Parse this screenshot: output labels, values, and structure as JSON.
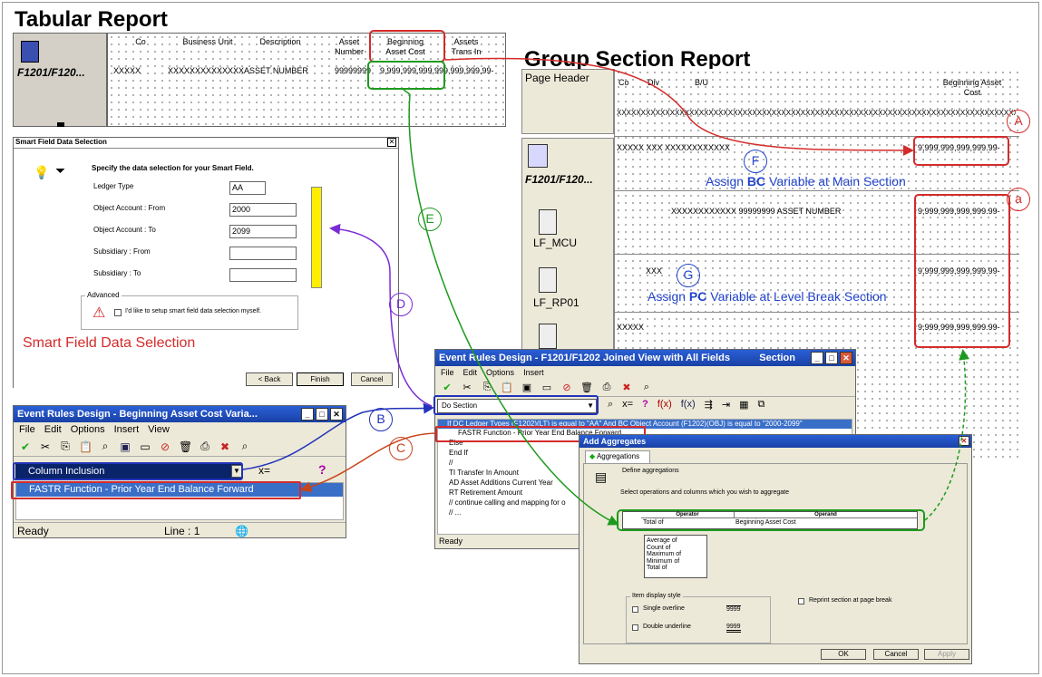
{
  "titles": {
    "tabular": "Tabular Report",
    "group": "Group Section Report"
  },
  "tabular": {
    "section_label": "F1201/F120...",
    "columns": [
      "Co",
      "Business Unit",
      "Description",
      "Asset Number",
      "Beginning Asset Cost",
      "Assets Trans In"
    ],
    "values": [
      "XXXXX",
      "XXXXXXXXXXXXXX",
      "ASSET NUMBER",
      "99999999",
      "9,999,999,999,99",
      "9,999,999,99-"
    ]
  },
  "group": {
    "page_header": "Page Header",
    "header_cols": {
      "co": "Co",
      "div": "Div",
      "bu": "B/U",
      "bac": "Beginning Asset Cost"
    },
    "x_line": "XXXXXXXXXXXXXXXXXXXXXXXXXXXXXXXXXXXXXXXXXXXXXXXXXXXXXXXXXXXXXXXXXXXXXXXXXXXXXXXXXXXXXXXXXXXXXXXXXXXXXXXXXXXXXXXX",
    "main_label": "F1201/F120...",
    "main_row": "XXXXX  XXX  XXXXXXXXXXXX",
    "value": "9,999,999,999,999.99-",
    "lf_mcu": "LF_MCU",
    "lf_mcu_row": "XXXXXXXXXXXX  99999999  ASSET NUMBER",
    "lf_rp01": "LF_RP01",
    "lf_rp01_row": "XXX",
    "last_row": "XXXXX",
    "assign_bc": {
      "pre": "Assign ",
      "bold": "BC",
      "post": " Variable at Main Section"
    },
    "assign_pc": {
      "pre": "Assign ",
      "bold": "PC",
      "post": " Variable at Level Break Section"
    }
  },
  "smart_field": {
    "title": "Smart Field Data Selection",
    "heading": "Specify the data selection for your Smart Field.",
    "fields": [
      {
        "label": "Ledger Type",
        "value": "AA"
      },
      {
        "label": "Object Account : From",
        "value": "2000"
      },
      {
        "label": "Object Account : To",
        "value": "2099"
      },
      {
        "label": "Subsidiary : From",
        "value": ""
      },
      {
        "label": "Subsidiary : To",
        "value": ""
      }
    ],
    "advanced": "Advanced",
    "checkbox": "I'd like to setup smart field data selection myself.",
    "back": "< Back",
    "finish": "Finish",
    "cancel": "Cancel",
    "caption": "Smart Field Data Selection"
  },
  "er_small": {
    "title": "Event Rules Design - Beginning Asset Cost Varia...",
    "menu": [
      "File",
      "Edit",
      "Options",
      "Insert",
      "View"
    ],
    "dropdown": "Column Inclusion",
    "selected": "FASTR Function - Prior Year End Balance Forward",
    "status": "Ready",
    "line": "Line : 1"
  },
  "er_big": {
    "title": "Event Rules Design - F1201/F1202 Joined View with All Fields",
    "section": "Section",
    "menu": [
      "File",
      "Edit",
      "Options",
      "Insert"
    ],
    "dropdown": "Do Section",
    "lines": [
      "If DC Ledger Types (F1202)(LT) is equal to \"AA\" And BC Object Account (F1202)(OBJ) is equal to \"2000-2099\"",
      "FASTR Function - Prior Year End Balance Forward",
      "Else",
      "End If",
      "//",
      "TI Transfer In Amount",
      "AD Asset Additions Current Year",
      "RT Retirement Amount",
      "// continue calling and mapping for o",
      "// ..."
    ],
    "status": "Ready"
  },
  "aggr": {
    "title": "Add Aggregates",
    "tab": "Aggregations",
    "define": "Define aggregations",
    "select": "Select operations and columns which you wish to aggregate",
    "col_operator": "Operator",
    "col_operand": "Operand",
    "row_operator": "Total of",
    "row_operand": "Beginning Asset Cost",
    "options": [
      "Average of",
      "Count of",
      "Maximum of",
      "Minimum of",
      "Total of"
    ],
    "display_style": "Item display style",
    "single": "Single overline",
    "double": "Double underline",
    "sample": "9999",
    "reprint": "Reprint section at page break",
    "ok": "OK",
    "cancel": "Cancel",
    "apply": "Apply"
  },
  "markers": {
    "A": "A",
    "a": "a",
    "B": "B",
    "C": "C",
    "D": "D",
    "E": "E",
    "F": "F",
    "G": "G"
  }
}
